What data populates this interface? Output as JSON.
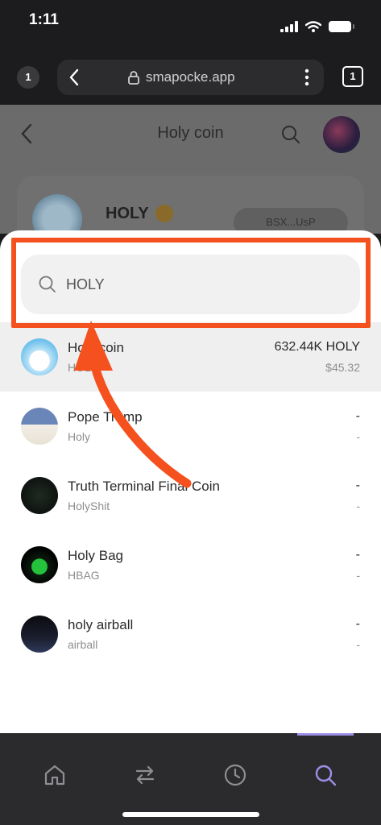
{
  "status": {
    "time": "1:11"
  },
  "browser": {
    "tab_count": "1",
    "url": "smapocke.app",
    "tabs_label": "1"
  },
  "page": {
    "title": "Holy coin",
    "token_name": "HOLY",
    "address": "BSX...UsP"
  },
  "search": {
    "query": "HOLY",
    "placeholder": ""
  },
  "results": [
    {
      "name": "Holy coin",
      "symbol": "HOLY",
      "balance": "632.44K HOLY",
      "usd": "$45.32",
      "selected": true
    },
    {
      "name": "Pope Trump",
      "symbol": "Holy",
      "balance": "-",
      "usd": "-"
    },
    {
      "name": "Truth Terminal Final Coin",
      "symbol": "HolyShit",
      "balance": "-",
      "usd": "-"
    },
    {
      "name": "Holy Bag",
      "symbol": "HBAG",
      "balance": "-",
      "usd": "-"
    },
    {
      "name": "holy airball",
      "symbol": "airball",
      "balance": "-",
      "usd": "-"
    }
  ],
  "colors": {
    "annotation": "#f4511e",
    "accent": "#9d8ee6"
  },
  "nav": [
    "home-icon",
    "swap-icon",
    "history-icon",
    "search-icon"
  ]
}
